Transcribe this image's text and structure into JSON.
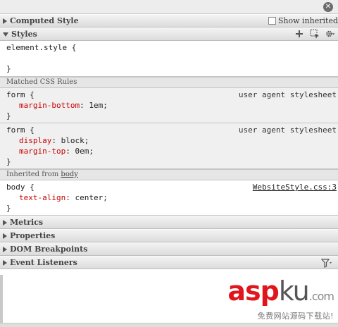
{
  "sections": {
    "computed_style": "Computed Style",
    "show_inherited": "Show inherited",
    "styles": "Styles",
    "metrics": "Metrics",
    "properties": "Properties",
    "dom_breakpoints": "DOM Breakpoints",
    "event_listeners": "Event Listeners"
  },
  "element_style": {
    "selector": "element.style {",
    "close": "}"
  },
  "matched_label": "Matched CSS Rules",
  "rules": [
    {
      "selector": "form {",
      "origin": "user agent stylesheet",
      "decls": [
        {
          "prop": "margin-bottom",
          "value": "1em;"
        }
      ],
      "close": "}"
    },
    {
      "selector": "form {",
      "origin": "user agent stylesheet",
      "decls": [
        {
          "prop": "display",
          "value": "block;"
        },
        {
          "prop": "margin-top",
          "value": "0em;"
        }
      ],
      "close": "}"
    }
  ],
  "inherited": {
    "prefix": "Inherited from",
    "element": "body"
  },
  "body_rule": {
    "selector": "body {",
    "origin": "WebsiteStyle.css:3",
    "decls": [
      {
        "prop": "text-align",
        "value": "center;"
      }
    ],
    "close": "}"
  },
  "watermark": {
    "asp": "asp",
    "ku": "ku",
    "com": ".com",
    "sub": "免费网站源码下载站!"
  },
  "colors": {
    "property": "#c80000",
    "watermark_red": "#e0161c"
  }
}
